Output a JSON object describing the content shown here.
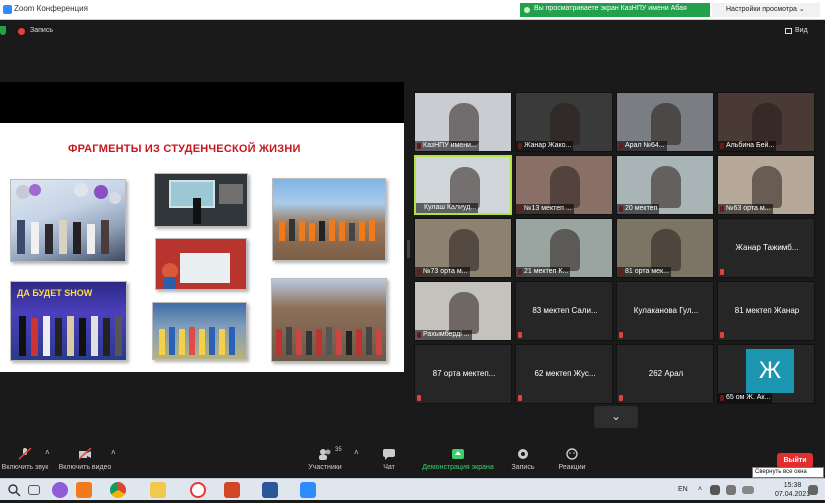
{
  "window": {
    "title": "Zoom Конференция"
  },
  "banner": {
    "sharing_text": "Вы просматриваете экран КазНПУ имени Абая",
    "view_options": "Настройки просмотра ⌄"
  },
  "recording": {
    "label": "Запись",
    "view_label": "Вид"
  },
  "slide": {
    "title": "ФРАГМЕНТЫ ИЗ СТУДЕНЧЕСКОЙ ЖИЗНИ",
    "show_banner": "ДА БУДЕТ SHOW"
  },
  "participants": [
    {
      "name": "КазНПУ имени...",
      "muted": true,
      "video": true,
      "bg": "#c9cdd2"
    },
    {
      "name": "Жанар Жако...",
      "muted": true,
      "video": true,
      "bg": "#3a3a3a"
    },
    {
      "name": "Арал №64...",
      "muted": true,
      "video": true,
      "bg": "#7a7d82"
    },
    {
      "name": "Альбина Бей...",
      "muted": true,
      "video": true,
      "bg": "#4a3a36"
    },
    {
      "name": "Кулаш Калиуд...",
      "muted": false,
      "video": true,
      "bg": "#cfd5d8",
      "active": true
    },
    {
      "name": "№13 мектеп ...",
      "muted": true,
      "video": true,
      "bg": "#8a6f66"
    },
    {
      "name": "20 мектеп",
      "muted": true,
      "video": true,
      "bg": "#a9b4b7"
    },
    {
      "name": "№63 орта м...",
      "muted": true,
      "video": true,
      "bg": "#b6a99a"
    },
    {
      "name": "№73 орта м...",
      "muted": true,
      "video": true,
      "bg": "#8d8272"
    },
    {
      "name": "21 мектеп К...",
      "muted": true,
      "video": true,
      "bg": "#9aa4a0"
    },
    {
      "name": "81 орта мек...",
      "muted": true,
      "video": true,
      "bg": "#7c7566"
    },
    {
      "name": "Жанар Тажимб...",
      "muted": true,
      "video": false
    },
    {
      "name": "Рахымберді ...",
      "muted": true,
      "video": true,
      "bg": "#c4c2bd"
    },
    {
      "name": "83 мектеп Сали...",
      "muted": true,
      "video": false
    },
    {
      "name": "Кулаканова Гул...",
      "muted": true,
      "video": false
    },
    {
      "name": "81 мектеп Жанар",
      "muted": true,
      "video": false
    },
    {
      "name": "87 орта мектеп...",
      "muted": true,
      "video": false
    },
    {
      "name": "62 мектеп Жус...",
      "muted": true,
      "video": false
    },
    {
      "name": "262 Арал",
      "muted": true,
      "video": false
    },
    {
      "name": "65 ом Ж. Ак...",
      "muted": true,
      "video": false,
      "avatar_letter": "Ж"
    }
  ],
  "toolbar": {
    "mic_label": "Включить звук",
    "video_label": "Включить видео",
    "participants_label": "Участники",
    "participants_count": "35",
    "chat_label": "Чат",
    "share_label": "Демонстрация экрана",
    "record_label": "Запись",
    "reactions_label": "Реакции",
    "leave_label": "Выйти",
    "tooltip": "Свернуть все окна"
  },
  "taskbar": {
    "lang": "EN",
    "time": "15:38",
    "date": "07.04.2021"
  },
  "colors": {
    "accent_green": "#22a04b",
    "leave_red": "#e02f2f",
    "slide_title_red": "#c8161e",
    "active_border": "#b2e33a"
  }
}
